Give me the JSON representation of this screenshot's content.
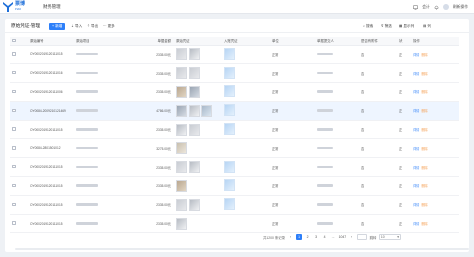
{
  "app": {
    "logo_text": "票博",
    "logo_sub": "PIAO",
    "nav_item": "财务管理"
  },
  "topbar": {
    "items": [
      "",
      "会计",
      "通知",
      "",
      "刷新操作"
    ]
  },
  "page": {
    "title": "原始凭证-管理"
  },
  "toolbar": {
    "primary_label": "新增",
    "import_label": "导入",
    "export_label": "导出",
    "more_label": "更多",
    "right": [
      "搜索",
      "筛选",
      "显示列",
      "列"
    ]
  },
  "table": {
    "headers": [
      "",
      "原始编号",
      "原始项目",
      "单据金额",
      "原始凭证",
      "入账凭证",
      "单位",
      "单据提交人",
      "是否有附件",
      "状",
      "操作"
    ],
    "rows": [
      {
        "id": "OY0002019120111015",
        "amount": "2335.00元",
        "thumbs": [
          "t0",
          "t3"
        ],
        "inv": true,
        "status": "正常",
        "attach": "否",
        "st": "正"
      },
      {
        "id": "OY0002019120111016",
        "amount": "2335.00元",
        "thumbs": [
          "t0",
          "t0"
        ],
        "inv": true,
        "status": "正常",
        "attach": "否",
        "st": "正"
      },
      {
        "id": "OY0002019120111006",
        "amount": "2335.00元",
        "thumbs": [
          "t1",
          "t2"
        ],
        "inv": true,
        "status": "正常",
        "attach": "否",
        "st": "正"
      },
      {
        "id": "OY0084-2009210121469",
        "amount": "4786.00元",
        "thumbs": [
          "t2",
          "t3",
          "t4"
        ],
        "inv": true,
        "status": "正常",
        "attach": "否",
        "st": "正",
        "selected": true
      },
      {
        "id": "OY0002019120111015",
        "amount": "2335.00元",
        "thumbs": [
          "t3",
          "t0"
        ],
        "inv": true,
        "status": "正常",
        "attach": "否",
        "st": "正"
      },
      {
        "id": "OY0084-2801501012",
        "amount": "3275.00元",
        "thumbs": [
          "t5"
        ],
        "inv": false,
        "status": "正常",
        "attach": "否",
        "st": "正"
      },
      {
        "id": "OY0002019120111015",
        "amount": "2335.00元",
        "thumbs": [
          "t0",
          "t3"
        ],
        "inv": true,
        "status": "正常",
        "attach": "否",
        "st": "正"
      },
      {
        "id": "OY0002019120111015",
        "amount": "2335.00元",
        "thumbs": [
          "t1"
        ],
        "inv": true,
        "status": "正常",
        "attach": "否",
        "st": "正"
      },
      {
        "id": "OY0002019120111015",
        "amount": "2335.00元",
        "thumbs": [
          "t0",
          "t3"
        ],
        "inv": true,
        "status": "正常",
        "attach": "否",
        "st": "正"
      },
      {
        "id": "OY0002019120111015",
        "amount": "2335.00元",
        "thumbs": [
          "t3"
        ],
        "inv": false,
        "status": "正常",
        "attach": "否",
        "st": "正"
      }
    ],
    "action_detail": "详情",
    "action_delete": "删除"
  },
  "pagination": {
    "total_text": "共1200 条记录",
    "pages": [
      "1",
      "2",
      "3",
      "4",
      "...",
      "1047"
    ],
    "active_page": 0,
    "goto_label": "跳转",
    "page_size": "10"
  },
  "colors": {
    "accent": "#2d7ff9",
    "danger": "#f5a35a"
  }
}
